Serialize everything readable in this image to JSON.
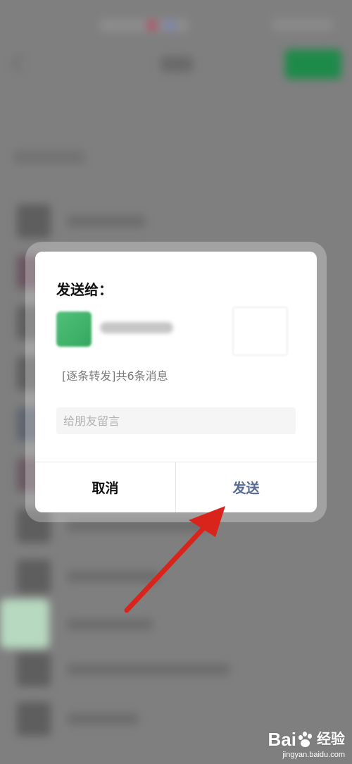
{
  "dialog": {
    "title": "发送给：",
    "forward_summary": "[逐条转发]共6条消息",
    "message_input": {
      "value": "",
      "placeholder": "给朋友留言"
    },
    "cancel_label": "取消",
    "send_label": "发送"
  },
  "watermark": {
    "brand": "Bai",
    "brand_suffix": "经验",
    "url": "jingyan.baidu.com"
  },
  "colors": {
    "send_button": "#576b95",
    "annotation_arrow": "#d9241c",
    "overlay": "#7f7f7f"
  },
  "icons": [
    "baidu-paw-icon",
    "annotation-arrow-icon"
  ]
}
